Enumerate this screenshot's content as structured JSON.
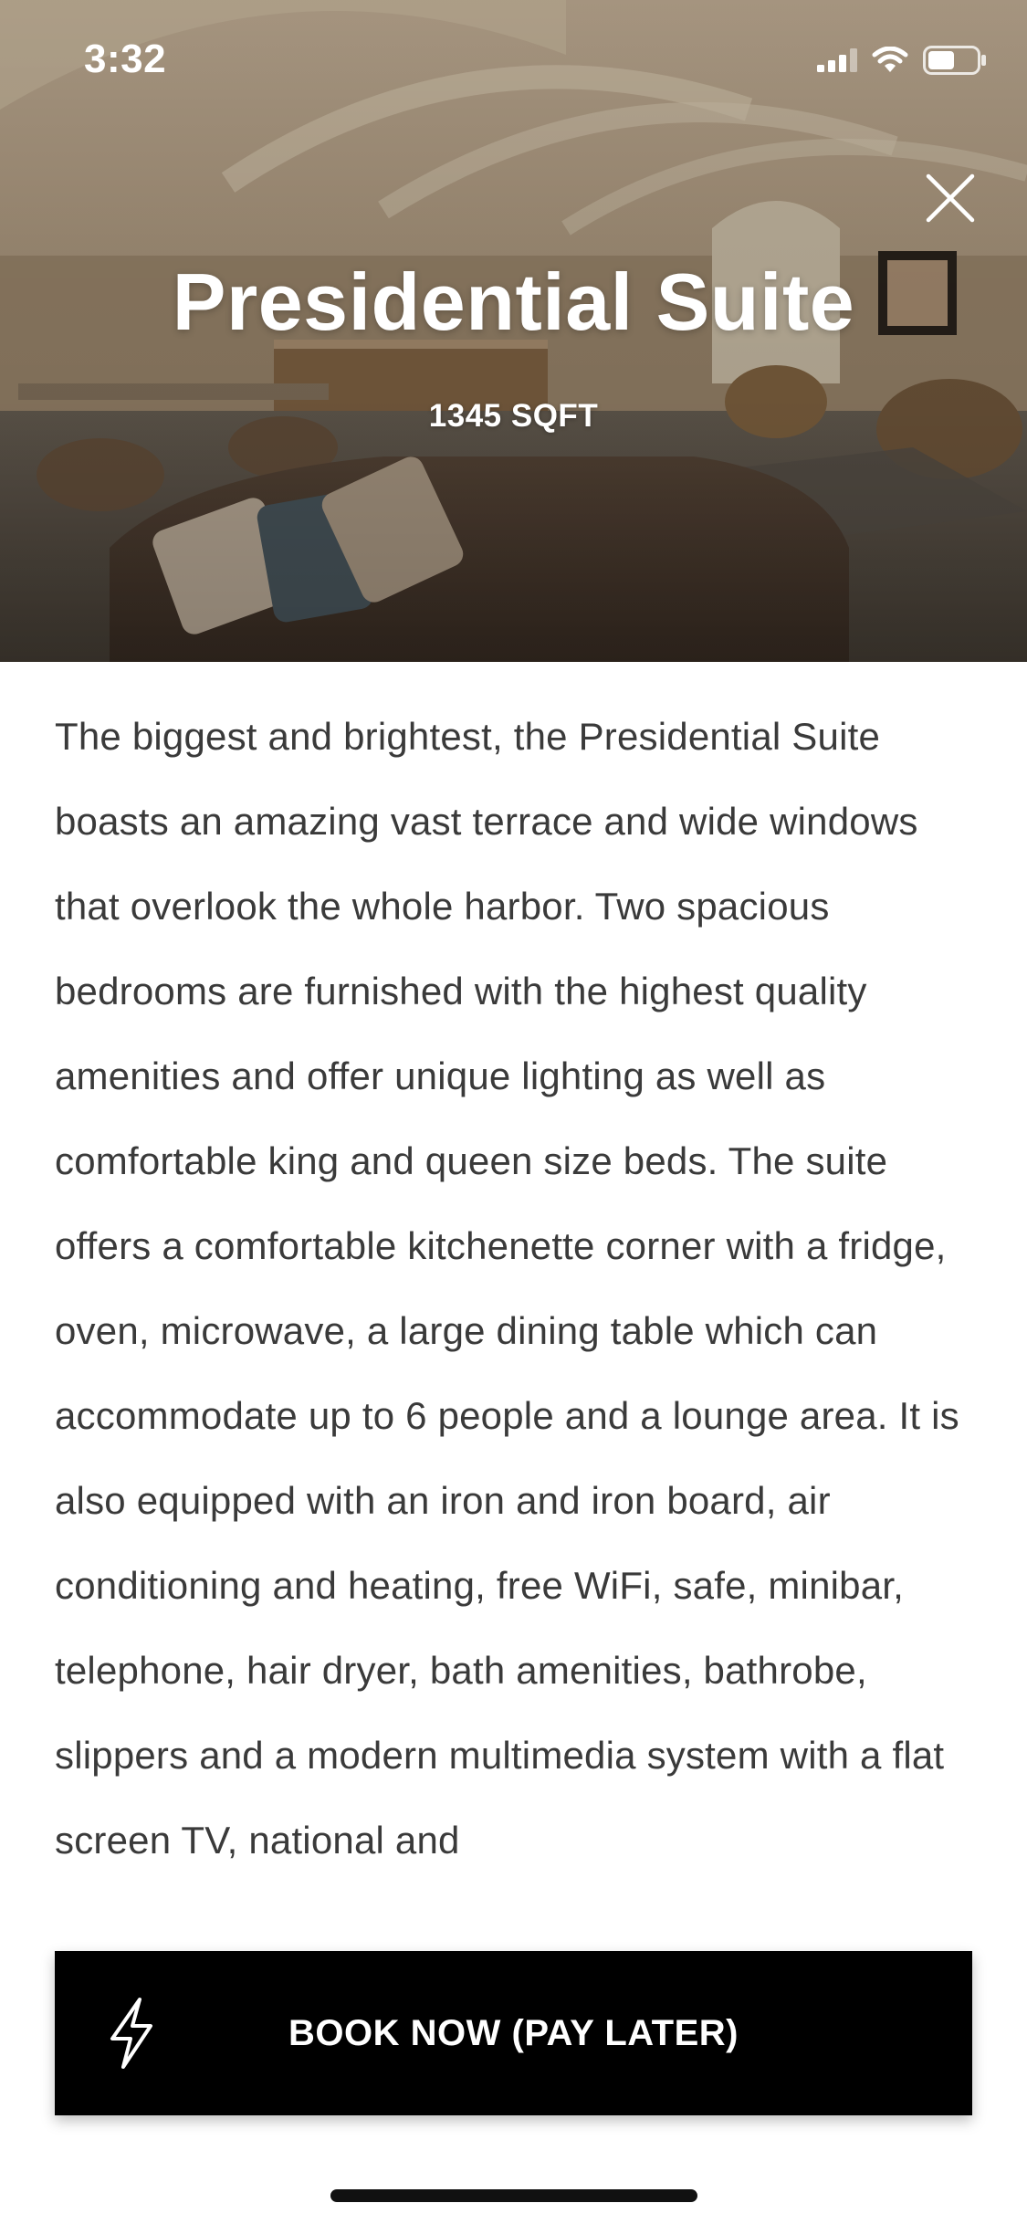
{
  "status_bar": {
    "time": "3:32",
    "icons": [
      "cellular-signal-icon",
      "wifi-icon",
      "battery-icon"
    ]
  },
  "hero": {
    "image": "hotel-suite-living-room-photo",
    "title": "Presidential Suite",
    "size": "1345 SQFT",
    "close_icon": "close-icon"
  },
  "description": "The biggest and brightest, the Presidential Suite boasts an amazing vast terrace and wide windows that overlook the whole harbor. Two spacious bedrooms are furnished with the highest quality amenities and offer unique lighting as well as comfortable king and queen size beds. The suite offers a comfortable kitchenette corner with a fridge, oven, microwave, a large dining table which can accommodate up to 6 people and a lounge area. It is also equipped with an iron and iron board, air conditioning and heating, free WiFi, safe, minibar, telephone, hair dryer, bath amenities, bathrobe, slippers and a modern multimedia system with a flat screen TV, national and",
  "book_button": {
    "label": "BOOK NOW (PAY LATER)",
    "icon": "lightning-bolt-icon"
  },
  "colors": {
    "button_background": "#000000",
    "button_text": "#ffffff",
    "body_text": "#3a3a3a",
    "page_background": "#ffffff"
  }
}
